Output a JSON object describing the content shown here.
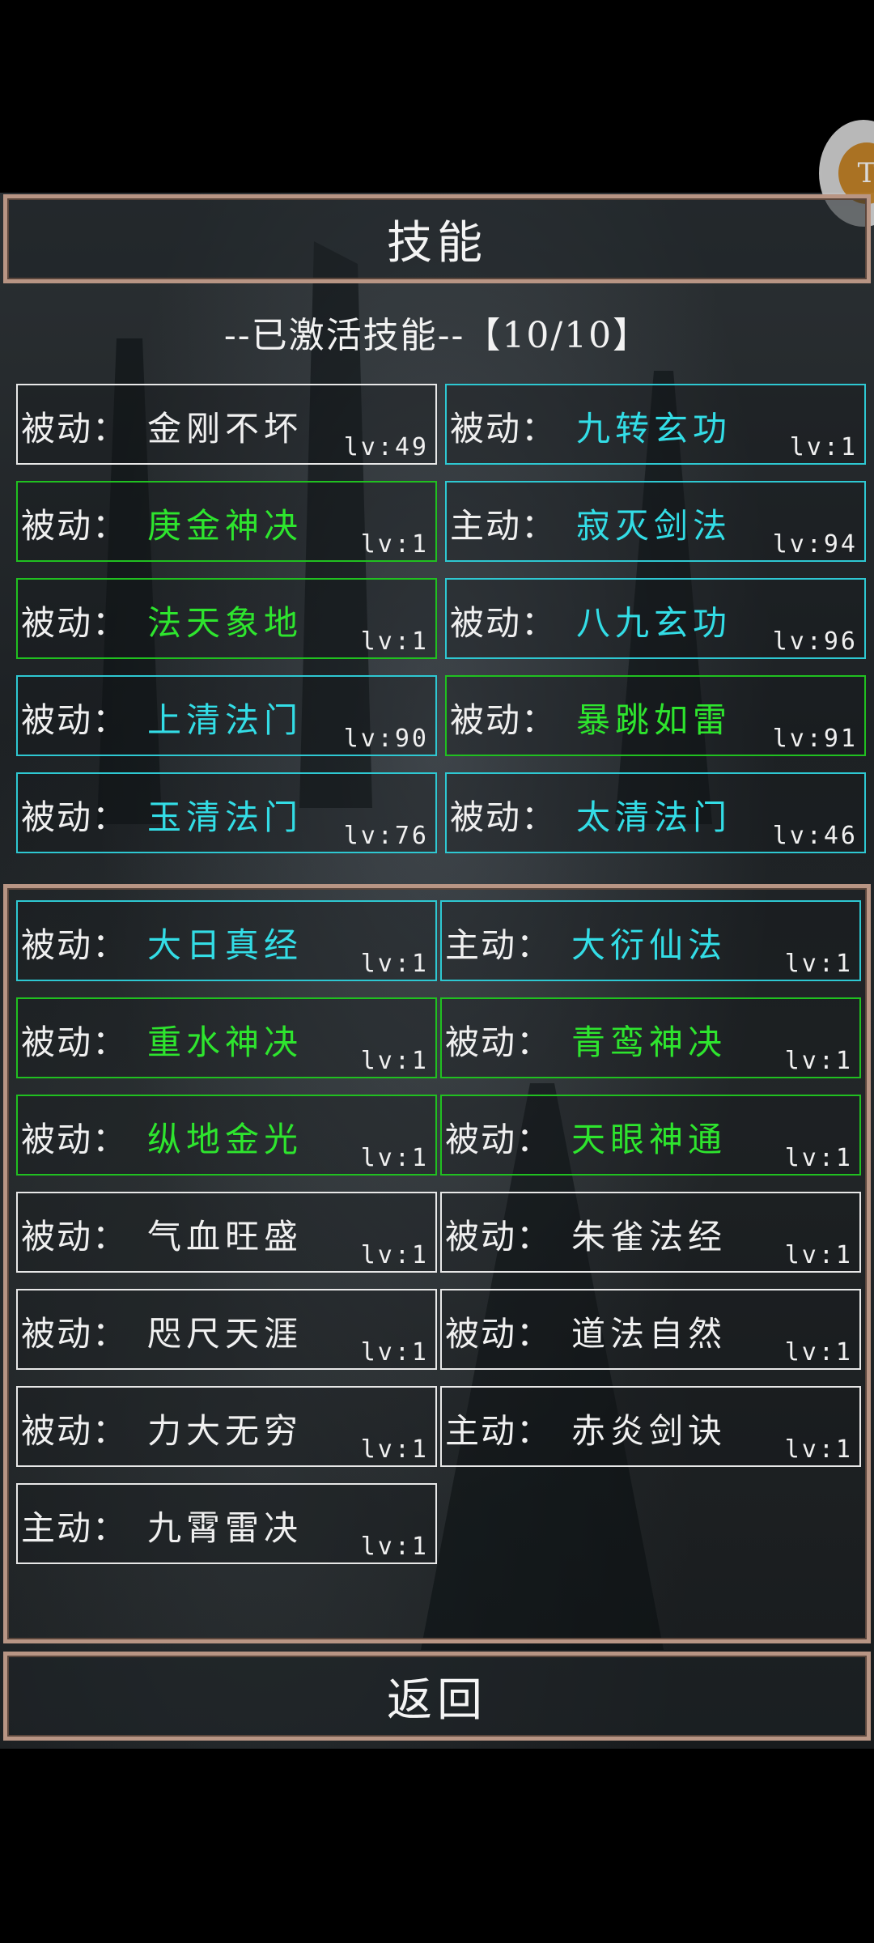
{
  "title": "技能",
  "active_header": "--已激活技能--【10/10】",
  "return_label": "返回",
  "corner_icon_glyph": "T",
  "colors": {
    "frame": "#b89584",
    "white": "#f0f0f0",
    "cyan": "#33dde6",
    "green": "#2ee52e"
  },
  "active_skills": [
    {
      "type": "被动：",
      "name": "金刚不坏",
      "lv": "lv:49",
      "color": "white"
    },
    {
      "type": "被动：",
      "name": "九转玄功",
      "lv": "lv:1",
      "color": "cyan"
    },
    {
      "type": "被动：",
      "name": "庚金神决",
      "lv": "lv:1",
      "color": "green"
    },
    {
      "type": "主动：",
      "name": "寂灭剑法",
      "lv": "lv:94",
      "color": "cyan"
    },
    {
      "type": "被动：",
      "name": "法天象地",
      "lv": "lv:1",
      "color": "green"
    },
    {
      "type": "被动：",
      "name": "八九玄功",
      "lv": "lv:96",
      "color": "cyan"
    },
    {
      "type": "被动：",
      "name": "上清法门",
      "lv": "lv:90",
      "color": "cyan"
    },
    {
      "type": "被动：",
      "name": "暴跳如雷",
      "lv": "lv:91",
      "color": "green"
    },
    {
      "type": "被动：",
      "name": "玉清法门",
      "lv": "lv:76",
      "color": "cyan"
    },
    {
      "type": "被动：",
      "name": "太清法门",
      "lv": "lv:46",
      "color": "cyan"
    }
  ],
  "available_skills": [
    {
      "type": "被动：",
      "name": "大日真经",
      "lv": "lv:1",
      "color": "cyan"
    },
    {
      "type": "主动：",
      "name": "大衍仙法",
      "lv": "lv:1",
      "color": "cyan"
    },
    {
      "type": "被动：",
      "name": "重水神决",
      "lv": "lv:1",
      "color": "green"
    },
    {
      "type": "被动：",
      "name": "青鸾神决",
      "lv": "lv:1",
      "color": "green"
    },
    {
      "type": "被动：",
      "name": "纵地金光",
      "lv": "lv:1",
      "color": "green"
    },
    {
      "type": "被动：",
      "name": "天眼神通",
      "lv": "lv:1",
      "color": "green"
    },
    {
      "type": "被动：",
      "name": "气血旺盛",
      "lv": "lv:1",
      "color": "white"
    },
    {
      "type": "被动：",
      "name": "朱雀法经",
      "lv": "lv:1",
      "color": "white"
    },
    {
      "type": "被动：",
      "name": "咫尺天涯",
      "lv": "lv:1",
      "color": "white"
    },
    {
      "type": "被动：",
      "name": "道法自然",
      "lv": "lv:1",
      "color": "white"
    },
    {
      "type": "被动：",
      "name": "力大无穷",
      "lv": "lv:1",
      "color": "white"
    },
    {
      "type": "主动：",
      "name": "赤炎剑诀",
      "lv": "lv:1",
      "color": "white"
    },
    {
      "type": "主动：",
      "name": "九霄雷决",
      "lv": "lv:1",
      "color": "white"
    }
  ]
}
